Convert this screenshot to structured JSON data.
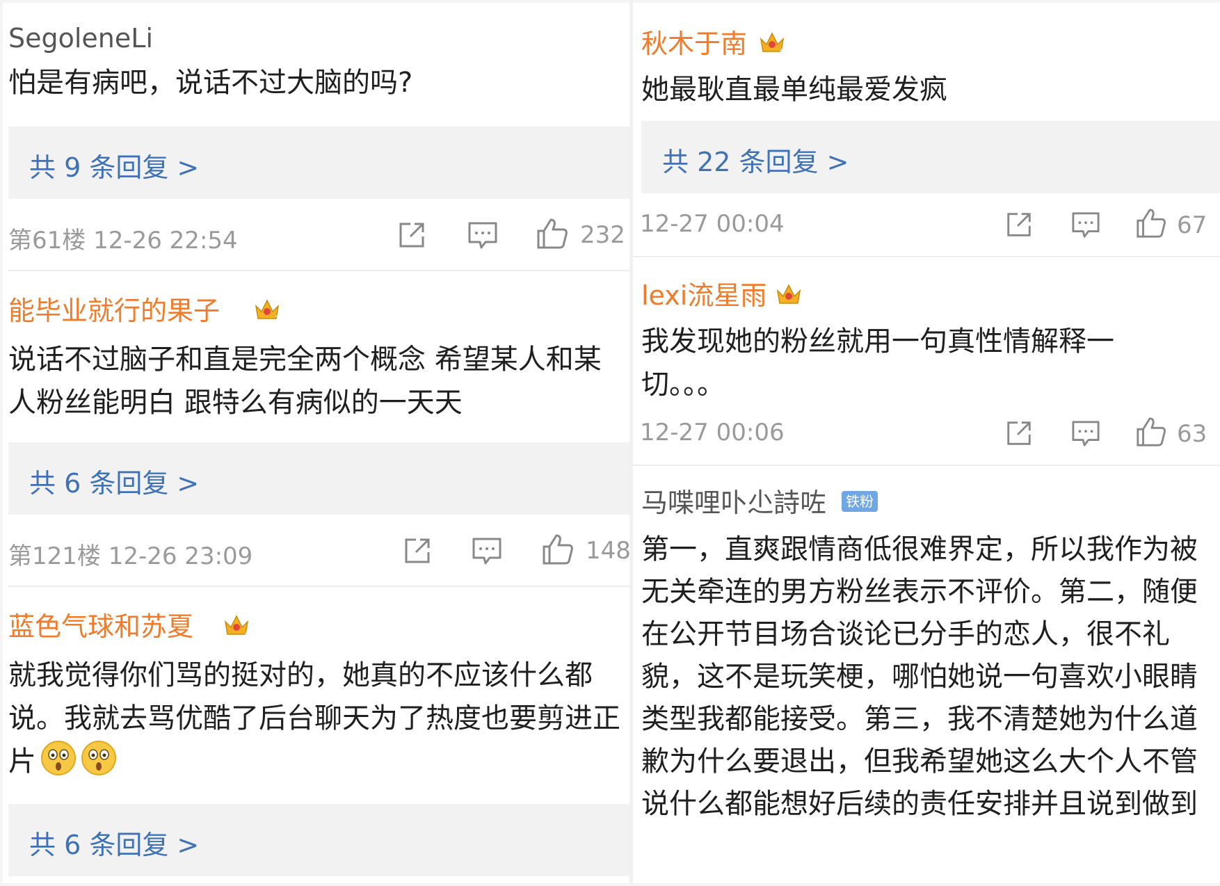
{
  "left_column": {
    "comments": [
      {
        "username": "SegoleneLi",
        "text": "怕是有病吧，说话不过大脑的吗?",
        "replies": "共 9 条回复 >",
        "meta": "第61楼 12-26 22:54",
        "likes": "232"
      },
      {
        "username": "能毕业就行的果子",
        "badge_level": "2",
        "text": "说话不过脑子和直是完全两个概念 希望某人和某人粉丝能明白 跟特么有病似的一天天",
        "replies": "共 6 条回复 >",
        "meta": "第121楼 12-26 23:09",
        "likes": "148"
      },
      {
        "username": "蓝色气球和苏夏",
        "badge_level": "4",
        "text": "就我觉得你们骂的挺对的，她真的不应该什么都说。我就去骂优酷了后台聊天为了热度也要剪进正片",
        "emojis": [
          "astonished-emoji",
          "astonished-emoji"
        ],
        "replies": "共 6 条回复 >"
      }
    ]
  },
  "right_column": {
    "comments": [
      {
        "username": "秋木于南",
        "badge_level": "6",
        "text": "她最耿直最单纯最爱发疯",
        "replies": "共 22 条回复 >",
        "meta": "12-27 00:04",
        "likes": "67"
      },
      {
        "username": "lexi流星雨",
        "text": "我发现她的粉丝就用一句真性情解释一切。。。",
        "meta": "12-27 00:06",
        "likes": "63"
      },
      {
        "username": "马喋哩卟尐詩咗",
        "fan_badge": "铁粉",
        "text": "第一，直爽跟情商低很难界定，所以我作为被无关牵连的男方粉丝表示不评价。第二，随便在公开节目场合谈论已分手的恋人，很不礼貌，这不是玩笑梗，哪怕她说一句喜欢小眼睛类型我都能接受。第三，我不清楚她为什么道歉为什么要退出，但我希望她这么大个人不管说什么都能想好后续的责任安排并且说到做到"
      }
    ]
  },
  "colors": {
    "username_orange": "#f07b2a",
    "reply_link_blue": "#3f72b5",
    "meta_grey": "#9a9a9a",
    "reply_box_bg": "#f2f2f2",
    "fan_badge_blue": "#6fa6e4",
    "crown_gold": "#f4b020",
    "crown_red": "#e0463a"
  },
  "icons": [
    "share-icon",
    "comment-icon",
    "thumbs-up-icon",
    "crown-badge-icon"
  ]
}
